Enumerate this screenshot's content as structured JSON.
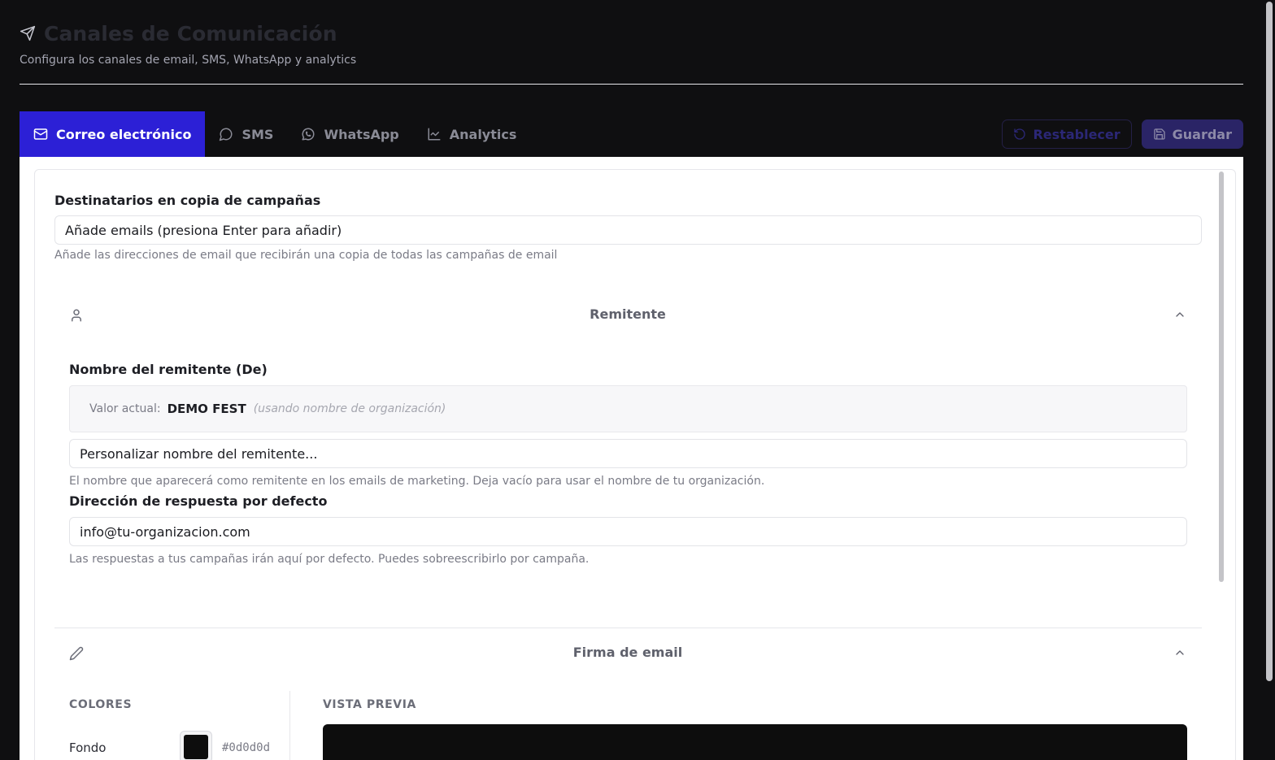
{
  "page": {
    "title": "Canales de Comunicación",
    "subtitle": "Configura los canales de email, SMS, WhatsApp y analytics"
  },
  "tabs": [
    {
      "label": "Correo electrónico",
      "icon": "mail-icon",
      "active": true
    },
    {
      "label": "SMS",
      "icon": "message-icon",
      "active": false
    },
    {
      "label": "WhatsApp",
      "icon": "whatsapp-icon",
      "active": false
    },
    {
      "label": "Analytics",
      "icon": "chart-line-icon",
      "active": false
    }
  ],
  "actions": {
    "reset_label": "Restablecer",
    "save_label": "Guardar"
  },
  "cc": {
    "label": "Destinatarios en copia de campañas",
    "placeholder": "Añade emails (presiona Enter para añadir)",
    "help": "Añade las direcciones de email que recibirán una copia de todas las campañas de email"
  },
  "sender_section": {
    "title": "Remitente",
    "icon": "user-icon",
    "name_label": "Nombre del remitente (De)",
    "current_label": "Valor actual:",
    "current_value": "DEMO FEST",
    "current_note": "(usando nombre de organización)",
    "name_placeholder": "Personalizar nombre del remitente...",
    "name_help": "El nombre que aparecerá como remitente en los emails de marketing. Deja vacío para usar el nombre de tu organización.",
    "reply_label": "Dirección de respuesta por defecto",
    "reply_placeholder": "info@tu-organizacion.com",
    "reply_help": "Las respuestas a tus campañas irán aquí por defecto. Puedes sobreescribirlo por campaña."
  },
  "signature_section": {
    "title": "Firma de email",
    "icon": "pencil-icon",
    "colors_heading": "COLORES",
    "preview_heading": "VISTA PREVIA",
    "background_label": "Fondo",
    "background_hex": "#0d0d0d"
  },
  "colors": {
    "accent": "#2c20d6",
    "swatch": "#0d0d0d"
  }
}
